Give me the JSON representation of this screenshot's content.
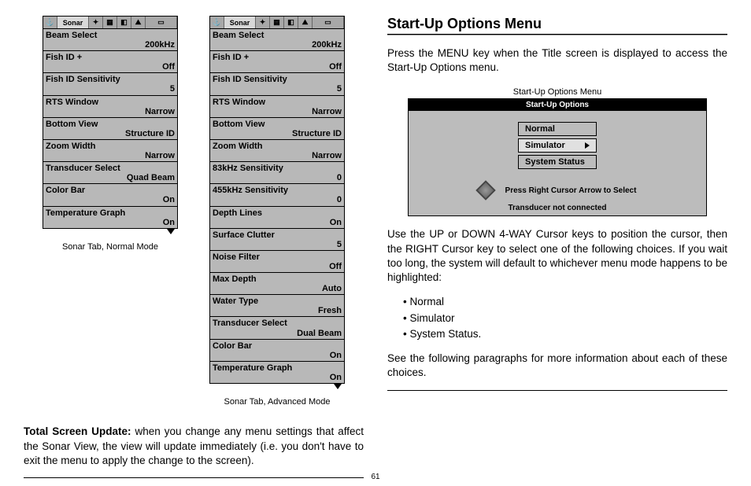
{
  "left": {
    "menu_normal": {
      "active_tab": "Sonar",
      "items": [
        {
          "label": "Beam Select",
          "value": "200kHz"
        },
        {
          "label": "Fish ID +",
          "value": "Off"
        },
        {
          "label": "Fish ID Sensitivity",
          "value": "5"
        },
        {
          "label": "RTS Window",
          "value": "Narrow"
        },
        {
          "label": "Bottom View",
          "value": "Structure ID"
        },
        {
          "label": "Zoom Width",
          "value": "Narrow"
        },
        {
          "label": "Transducer Select",
          "value": "Quad Beam"
        },
        {
          "label": "Color Bar",
          "value": "On"
        },
        {
          "label": "Temperature Graph",
          "value": "On"
        }
      ],
      "caption": "Sonar Tab, Normal Mode"
    },
    "menu_advanced": {
      "active_tab": "Sonar",
      "items": [
        {
          "label": "Beam Select",
          "value": "200kHz"
        },
        {
          "label": "Fish ID +",
          "value": "Off"
        },
        {
          "label": "Fish ID Sensitivity",
          "value": "5"
        },
        {
          "label": "RTS Window",
          "value": "Narrow"
        },
        {
          "label": "Bottom View",
          "value": "Structure ID"
        },
        {
          "label": "Zoom Width",
          "value": "Narrow"
        },
        {
          "label": "83kHz Sensitivity",
          "value": "0"
        },
        {
          "label": "455kHz Sensitivity",
          "value": "0"
        },
        {
          "label": "Depth Lines",
          "value": "On"
        },
        {
          "label": "Surface Clutter",
          "value": "5"
        },
        {
          "label": "Noise Filter",
          "value": "Off"
        },
        {
          "label": "Max Depth",
          "value": "Auto"
        },
        {
          "label": "Water Type",
          "value": "Fresh"
        },
        {
          "label": "Transducer Select",
          "value": "Dual Beam"
        },
        {
          "label": "Color Bar",
          "value": "On"
        },
        {
          "label": "Temperature Graph",
          "value": "On"
        }
      ],
      "caption": "Sonar Tab, Advanced Mode"
    },
    "body_bold": "Total Screen Update:",
    "body_text": " when you change any menu settings that affect the Sonar View, the view will update immediately (i.e. you don't have to exit the menu to apply the change to the screen)."
  },
  "right": {
    "title": "Start-Up Options Menu",
    "intro": "Press the MENU key when the Title screen is displayed to access the Start-Up Options menu.",
    "figure_caption": "Start-Up Options Menu",
    "startup": {
      "header": "Start-Up Options",
      "options": [
        "Normal",
        "Simulator",
        "System Status"
      ],
      "selected": "Simulator",
      "hint": "Press Right Cursor Arrow to Select",
      "status": "Transducer not connected"
    },
    "para2": "Use the UP or DOWN 4-WAY Cursor keys to position the cursor, then the RIGHT Cursor key to select one of the following choices. If you wait too long, the system will default to whichever menu mode happens to be highlighted:",
    "bullets": [
      "Normal",
      "Simulator",
      "System Status."
    ],
    "para3": "See the following paragraphs for more information about each of these choices."
  },
  "page_number": "61"
}
